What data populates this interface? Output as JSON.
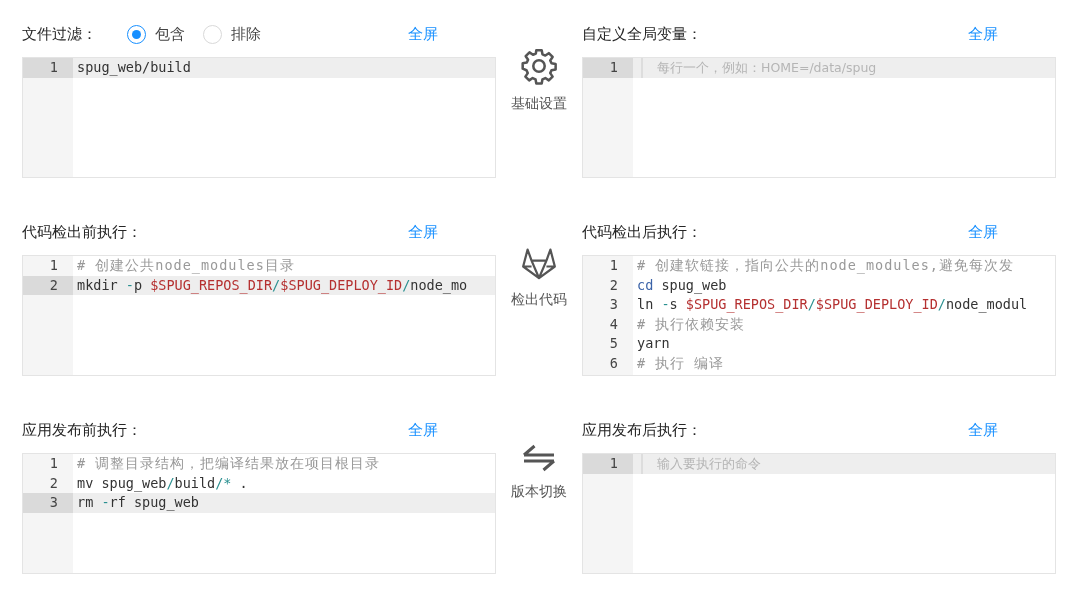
{
  "rows": [
    {
      "left": {
        "label": "文件过滤：",
        "options": [
          {
            "label": "包含",
            "selected": true
          },
          {
            "label": "排除",
            "selected": false
          }
        ],
        "link": "全屏",
        "editor": {
          "lines": [
            {
              "number": "1",
              "selected": true,
              "tokens": [
                {
                  "kind": "plain",
                  "text": "spug_web/build"
                }
              ]
            }
          ]
        }
      },
      "step": {
        "kind": "settings",
        "label": "基础设置"
      },
      "right": {
        "label": "自定义全局变量：",
        "link": "全屏",
        "editor": {
          "lines": [
            {
              "number": "1",
              "selected": true,
              "placeholder": "每行一个，例如：HOME=/data/spug"
            }
          ]
        }
      }
    },
    {
      "left": {
        "label": "代码检出前执行：",
        "link": "全屏",
        "editor": {
          "lines": [
            {
              "number": "1",
              "selected": false,
              "tokens": [
                {
                  "kind": "comment",
                  "text": "# 创建公共node_modules目录"
                }
              ]
            },
            {
              "number": "2",
              "selected": true,
              "tokens": [
                {
                  "kind": "plain",
                  "text": "mkdir "
                },
                {
                  "kind": "operator",
                  "text": "-"
                },
                {
                  "kind": "plain",
                  "text": "p "
                },
                {
                  "kind": "variable",
                  "text": "$SPUG_REPOS_DIR"
                },
                {
                  "kind": "operator",
                  "text": "/"
                },
                {
                  "kind": "variable",
                  "text": "$SPUG_DEPLOY_ID"
                },
                {
                  "kind": "operator",
                  "text": "/"
                },
                {
                  "kind": "plain",
                  "text": "node_mo"
                }
              ]
            }
          ]
        }
      },
      "step": {
        "kind": "checkout",
        "label": "检出代码"
      },
      "right": {
        "label": "代码检出后执行：",
        "link": "全屏",
        "editor": {
          "lines": [
            {
              "number": "1",
              "selected": false,
              "tokens": [
                {
                  "kind": "comment",
                  "text": "# 创建软链接，指向公共的node_modules,避免每次发"
                }
              ]
            },
            {
              "number": "2",
              "selected": false,
              "tokens": [
                {
                  "kind": "keyword",
                  "text": "cd"
                },
                {
                  "kind": "plain",
                  "text": " spug_web"
                }
              ]
            },
            {
              "number": "3",
              "selected": false,
              "tokens": [
                {
                  "kind": "plain",
                  "text": "ln "
                },
                {
                  "kind": "operator",
                  "text": "-"
                },
                {
                  "kind": "plain",
                  "text": "s "
                },
                {
                  "kind": "variable",
                  "text": "$SPUG_REPOS_DIR"
                },
                {
                  "kind": "operator",
                  "text": "/"
                },
                {
                  "kind": "variable",
                  "text": "$SPUG_DEPLOY_ID"
                },
                {
                  "kind": "operator",
                  "text": "/"
                },
                {
                  "kind": "plain",
                  "text": "node_modul"
                }
              ]
            },
            {
              "number": "4",
              "selected": false,
              "tokens": [
                {
                  "kind": "comment",
                  "text": "# 执行依赖安装"
                }
              ]
            },
            {
              "number": "5",
              "selected": false,
              "tokens": [
                {
                  "kind": "plain",
                  "text": "yarn"
                }
              ]
            },
            {
              "number": "6",
              "selected": false,
              "tokens": [
                {
                  "kind": "comment",
                  "text": "# 执行 编译"
                }
              ]
            }
          ]
        }
      }
    },
    {
      "left": {
        "label": "应用发布前执行：",
        "link": "全屏",
        "editor": {
          "lines": [
            {
              "number": "1",
              "selected": false,
              "tokens": [
                {
                  "kind": "comment",
                  "text": "# 调整目录结构，把编译结果放在项目根目录"
                }
              ]
            },
            {
              "number": "2",
              "selected": false,
              "tokens": [
                {
                  "kind": "plain",
                  "text": "mv spug_web"
                },
                {
                  "kind": "operator",
                  "text": "/"
                },
                {
                  "kind": "plain",
                  "text": "build"
                },
                {
                  "kind": "operator",
                  "text": "/*"
                },
                {
                  "kind": "plain",
                  "text": " ."
                }
              ]
            },
            {
              "number": "3",
              "selected": true,
              "tokens": [
                {
                  "kind": "plain",
                  "text": "rm "
                },
                {
                  "kind": "operator",
                  "text": "-"
                },
                {
                  "kind": "plain",
                  "text": "rf spug_web"
                }
              ]
            }
          ]
        }
      },
      "step": {
        "kind": "switch",
        "label": "版本切换"
      },
      "right": {
        "label": "应用发布后执行：",
        "link": "全屏",
        "editor": {
          "lines": [
            {
              "number": "1",
              "selected": true,
              "placeholder": "输入要执行的命令"
            }
          ]
        }
      }
    }
  ]
}
